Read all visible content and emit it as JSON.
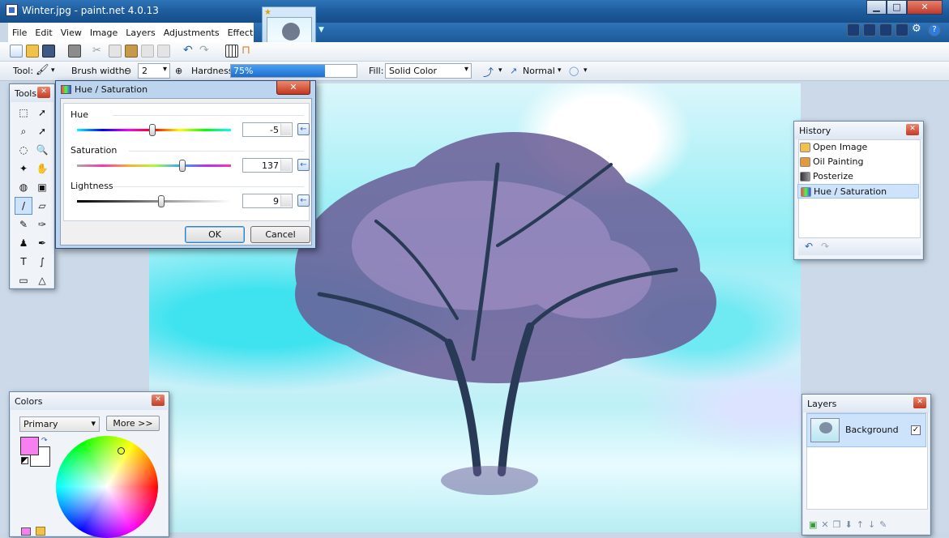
{
  "window": {
    "title": "Winter.jpg - paint.net 4.0.13"
  },
  "menu": [
    "File",
    "Edit",
    "View",
    "Image",
    "Layers",
    "Adjustments",
    "Effects"
  ],
  "toolbar2": {
    "tool_label": "Tool:",
    "brush_width_label": "Brush width:",
    "brush_width_value": "2",
    "hardness_label": "Hardness:",
    "hardness_value": "75%",
    "hardness_fraction": 0.75,
    "fill_label": "Fill:",
    "fill_value": "Solid Color",
    "blend_mode": "Normal"
  },
  "tools_panel": {
    "title": "Tools"
  },
  "dialog": {
    "title": "Hue / Saturation",
    "hue": {
      "label": "Hue",
      "value": "-5",
      "fraction": 0.49
    },
    "saturation": {
      "label": "Saturation",
      "value": "137",
      "fraction": 0.685
    },
    "lightness": {
      "label": "Lightness",
      "value": "9",
      "fraction": 0.545
    },
    "ok_label": "OK",
    "cancel_label": "Cancel"
  },
  "history": {
    "title": "History",
    "items": [
      {
        "label": "Open Image",
        "icon": "open-image-icon"
      },
      {
        "label": "Oil Painting",
        "icon": "oil-painting-icon"
      },
      {
        "label": "Posterize",
        "icon": "posterize-icon"
      },
      {
        "label": "Hue / Saturation",
        "icon": "hue-saturation-icon",
        "selected": true
      }
    ]
  },
  "colors": {
    "title": "Colors",
    "selector": "Primary",
    "more_label": "More >>",
    "primary": "#f77ff0",
    "secondary": "#ffffff"
  },
  "layers": {
    "title": "Layers",
    "items": [
      {
        "name": "Background",
        "visible": true
      }
    ]
  }
}
